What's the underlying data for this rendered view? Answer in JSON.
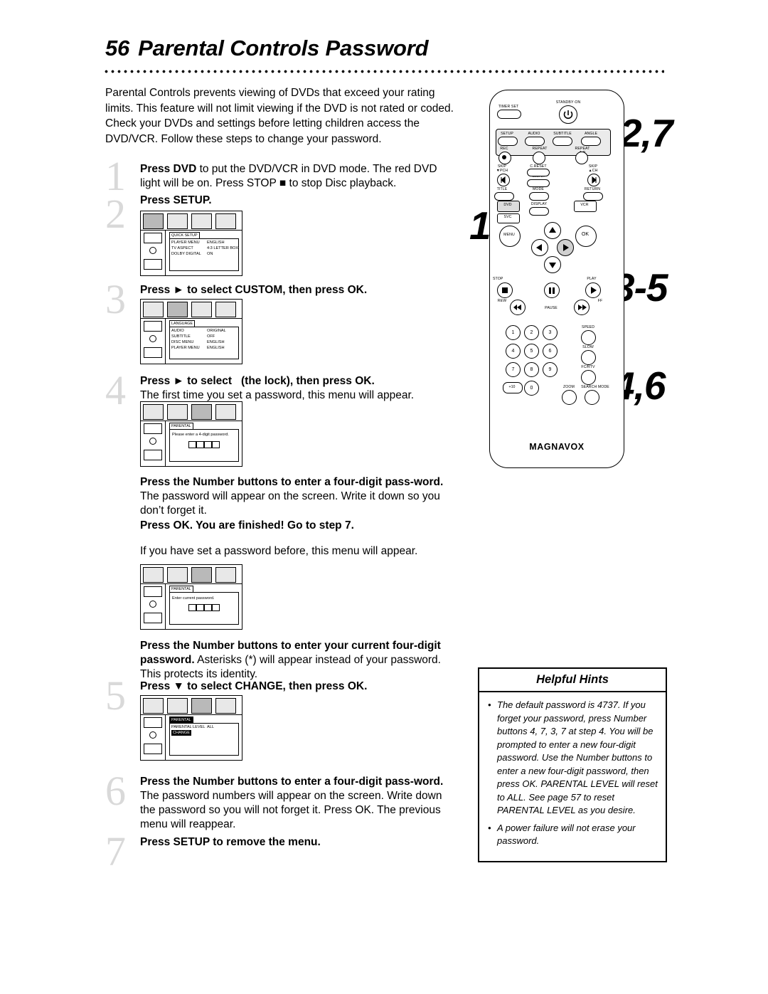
{
  "header": {
    "page_number": "56",
    "title": "Parental Controls Password"
  },
  "intro": "Parental Controls prevents viewing of DVDs that exceed your rating limits. This feature will not limit viewing if the DVD is not rated or coded. Check your DVDs and settings before letting children access the DVD/VCR. Follow these steps to change your password.",
  "steps": [
    {
      "num": "1",
      "lead": "Press DVD",
      "text": " to put the DVD/VCR in DVD mode. The red DVD light will be on. Press STOP ■ to stop Disc playback."
    },
    {
      "num": "2",
      "lead": "Press SETUP.",
      "text": ""
    },
    {
      "num": "3",
      "lead": "Press ► to select CUSTOM, then press OK.",
      "text": ""
    },
    {
      "num": "4",
      "lead": "Press ► to select   (the lock), then press OK.",
      "text": "The first time you set a password, this menu will appear."
    },
    {
      "num": "5",
      "lead": "Press ▼ to select CHANGE, then press OK.",
      "text": ""
    },
    {
      "num": "6",
      "lead": "Press the Number buttons to enter a four-digit pass-word.",
      "text": " The password numbers will appear on the screen. Write down the password so you will not forget it. Press OK. The previous menu will reappear."
    },
    {
      "num": "7",
      "lead": "Press SETUP to remove the menu.",
      "text": ""
    }
  ],
  "paragraphs": {
    "p_first_password_bold": "Press the Number buttons to enter a four-digit pass-word.",
    "p_first_password_rest": " The password will appear on the screen. Write it down so you don’t forget it.",
    "p_press_ok_bold": "Press OK. You are finished! Go to step 7.",
    "p_if_set_before": "If you have set a password before, this menu will appear.",
    "p_current_bold": "Press the Number buttons to enter your current four-digit password.",
    "p_current_rest": " Asterisks (*) will appear instead of your password. This protects its identity."
  },
  "right_step_numbers": [
    "2,7",
    "1",
    "3-5",
    "4,6"
  ],
  "osd_menus": {
    "setup": {
      "tab": "QUICK SETUP",
      "rows": [
        {
          "label": "PLAYER MENU",
          "value": "ENGLISH"
        },
        {
          "label": "TV ASPECT",
          "value": "4:3 LETTER BOX"
        },
        {
          "label": "DOLBY DIGITAL",
          "value": "ON"
        }
      ]
    },
    "language": {
      "tab": "LANGUAGE",
      "rows": [
        {
          "label": "AUDIO",
          "value": "ORIGINAL"
        },
        {
          "label": "SUBTITLE",
          "value": "OFF"
        },
        {
          "label": "DISC MENU",
          "value": "ENGLISH"
        },
        {
          "label": "PLAYER MENU",
          "value": "ENGLISH"
        }
      ]
    },
    "parental_new": {
      "tab": "PARENTAL",
      "prompt": "Please  enter  a  4-digit  password."
    },
    "parental_current": {
      "tab": "PARENTAL",
      "prompt": "Enter  current  password."
    },
    "parental_change": {
      "tab": "PARENTAL",
      "rows": [
        {
          "label": "PARENTAL LEVEL",
          "value": "ALL"
        },
        {
          "label": "CHANGE",
          "value": ""
        }
      ]
    }
  },
  "remote": {
    "brand": "MAGNAVOX",
    "labels": {
      "timer_set": "TIMER SET",
      "standby_on": "STANDBY·ON",
      "setup": "SETUP",
      "audio": "AUDIO",
      "subtitle": "SUBTITLE",
      "angle": "ANGLE",
      "rec": "REC",
      "repeat": "REPEAT",
      "repeat_ab": "REPEAT",
      "ab": "A-B",
      "c_reset": "C.RESET",
      "clear": "CLEAR",
      "skip_left": "SKIP",
      "skip_right": "SKIP",
      "pch": "▼PCH",
      "chup": "▲CH",
      "title": "TITLE",
      "mode": "MODE",
      "return": "RETURN",
      "display": "DISPLAY",
      "dvd": "DVD",
      "vcr": "VCR",
      "svc": "SVC",
      "menu": "MENU",
      "ok": "OK",
      "stop": "STOP",
      "play": "PLAY",
      "pause": "PAUSE",
      "rew": "REW",
      "ff": "FF",
      "speed": "SPEED",
      "slow": "SLOW",
      "fcrtv": "FC/RTV",
      "zoom": "ZOOM",
      "search_mode": "SEARCH MODE",
      "plus10": "+10"
    },
    "keypad": [
      "1",
      "2",
      "3",
      "4",
      "5",
      "6",
      "7",
      "8",
      "9",
      "0"
    ]
  },
  "hints": {
    "title": "Helpful Hints",
    "items": [
      "The default password is 4737. If you forget your password, press Number buttons 4, 7, 3, 7 at step 4. You will be prompted to enter a new four-digit password. Use the Number buttons to enter a new four-digit password, then press OK. PARENTAL LEVEL will reset to ALL. See page 57 to reset PARENTAL LEVEL as you desire.",
      "A power failure will not erase your password."
    ]
  }
}
